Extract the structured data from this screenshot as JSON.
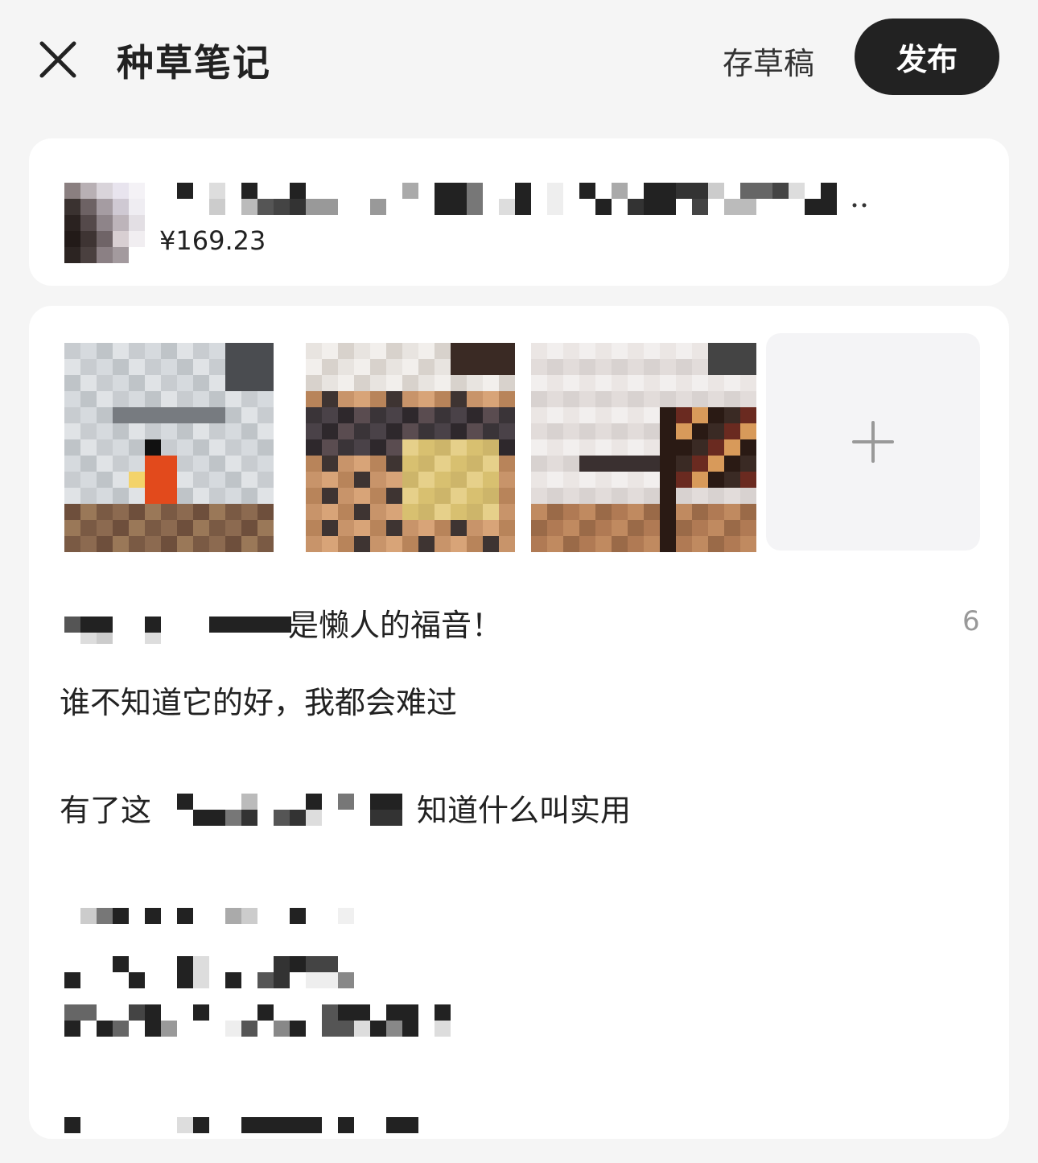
{
  "header": {
    "title": "种草笔记",
    "draft_label": "存草稿",
    "publish_label": "发布"
  },
  "product": {
    "price": "¥169.23"
  },
  "note": {
    "title_suffix": "是懒人的福音！",
    "title_counter": "6",
    "body_line_1": "谁不知道它的好，我都会难过",
    "body_line_2_prefix": "有了这",
    "body_line_2_suffix": "知道什么叫实用"
  },
  "colors": {
    "publish_bg": "#222222",
    "text_primary": "#222222",
    "text_muted": "#999999"
  },
  "icons": {
    "close": "close-icon",
    "add": "plus-icon"
  }
}
